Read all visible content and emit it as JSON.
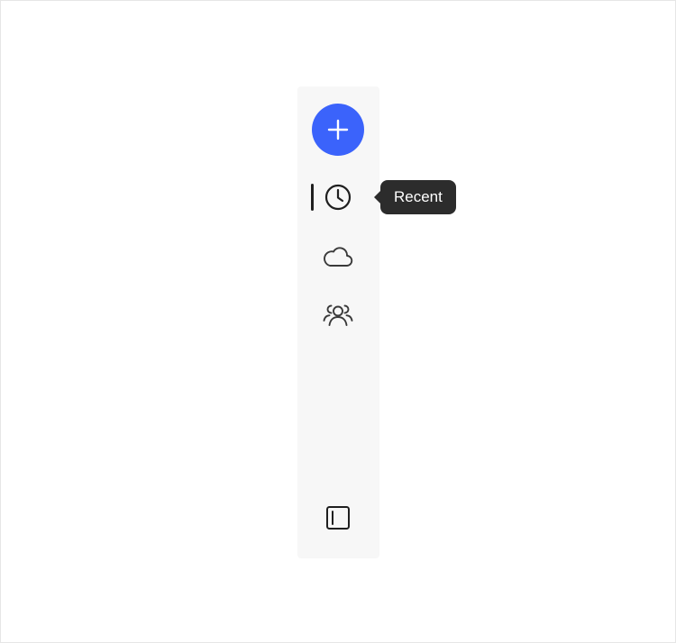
{
  "nav": {
    "create": {
      "icon": "plus-icon",
      "color": "#3b63fb"
    },
    "items": [
      {
        "id": "recent",
        "icon": "clock-icon",
        "selected": true
      },
      {
        "id": "cloud",
        "icon": "cloud-icon",
        "selected": false
      },
      {
        "id": "shared",
        "icon": "people-icon",
        "selected": false
      }
    ],
    "footer": {
      "icon": "panel-toggle-icon"
    }
  },
  "tooltip": {
    "text": "Recent"
  },
  "colors": {
    "accent": "#3b63fb",
    "rail_bg": "#f7f7f7",
    "tooltip_bg": "#2c2c2c",
    "icon": "#1f1f1f"
  }
}
